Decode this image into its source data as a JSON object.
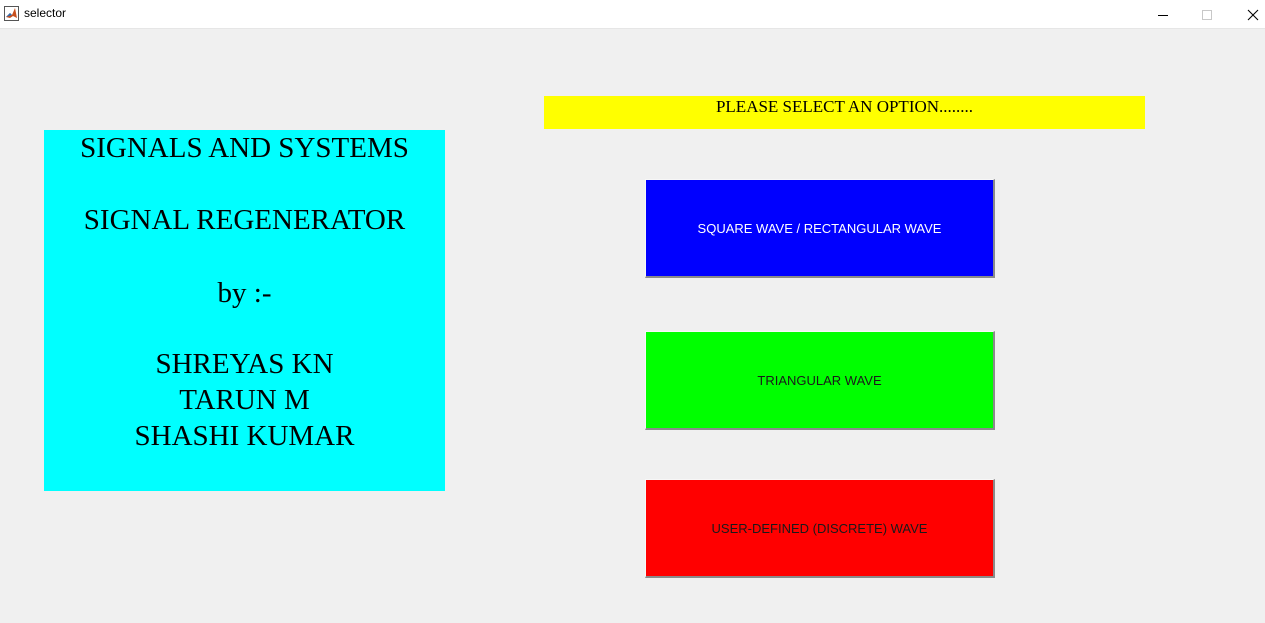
{
  "window": {
    "title": "selector",
    "icon": "matlab-icon",
    "controls": [
      "minimize-icon",
      "maximize-icon",
      "close-icon"
    ]
  },
  "info_panel": {
    "background": "#00ffff",
    "lines": [
      "SIGNALS AND SYSTEMS",
      "SIGNAL REGENERATOR",
      "by :-",
      "SHREYAS KN",
      "TARUN M",
      "SHASHI KUMAR"
    ]
  },
  "prompt": {
    "text": "PLEASE SELECT AN OPTION........",
    "background": "#ffff00"
  },
  "buttons": [
    {
      "label": "SQUARE WAVE / RECTANGULAR WAVE",
      "background": "#0000ff",
      "color": "#ffffff"
    },
    {
      "label": "TRIANGULAR WAVE",
      "background": "#00ff00",
      "color": "#1a1a1a"
    },
    {
      "label": "USER-DEFINED (DISCRETE) WAVE",
      "background": "#ff0000",
      "color": "#1a1a1a"
    }
  ]
}
